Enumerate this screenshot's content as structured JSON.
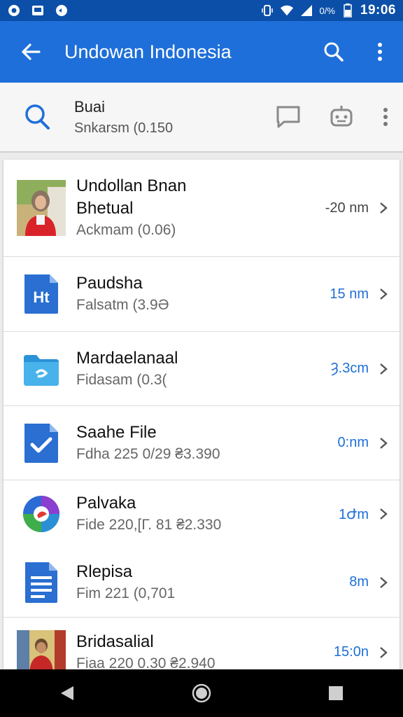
{
  "status": {
    "time": "19:06",
    "battery_pct": "0/%"
  },
  "appbar": {
    "title": "Undowan Indonesia"
  },
  "toolbar": {
    "line1": "Buai",
    "line2": "Snkarsm (0.150"
  },
  "items": [
    {
      "name": "Undollan Bnan",
      "name2": "Bhetual",
      "sub": "Ackmam (0.06)",
      "time": "-20 nm",
      "icon": "photo-avatar"
    },
    {
      "name": "Paudsha",
      "sub": "Falsatm (3.9Ә",
      "time": "15 nm",
      "icon": "doc-ht-icon",
      "icon_text": "Ht"
    },
    {
      "name": "Mardaelanaal",
      "sub": "Fidasam (0.3(",
      "time": "Ȝ.3cm",
      "icon": "folder-icon"
    },
    {
      "name": "Saahe File",
      "sub": "Fdha 225 0/29 ₴3.390",
      "time": "0:nm",
      "icon": "check-doc-icon"
    },
    {
      "name": "Palvaka",
      "sub": "Fide 220,[Г. 81 ₴2.330",
      "time": "1Ժm",
      "icon": "colorful-logo-icon"
    },
    {
      "name": "Rlepisa",
      "sub": "Fim 221 (0,701",
      "time": "8m",
      "icon": "list-doc-icon"
    },
    {
      "name": "Bridasalial",
      "sub": "Fiaa 220 0.30 ₴2.940",
      "time": "15:0n",
      "icon": "photo-avatar-2"
    }
  ],
  "colors": {
    "primary": "#1e6fd9",
    "status": "#0b4fa8",
    "accent": "#1e6fd9"
  }
}
